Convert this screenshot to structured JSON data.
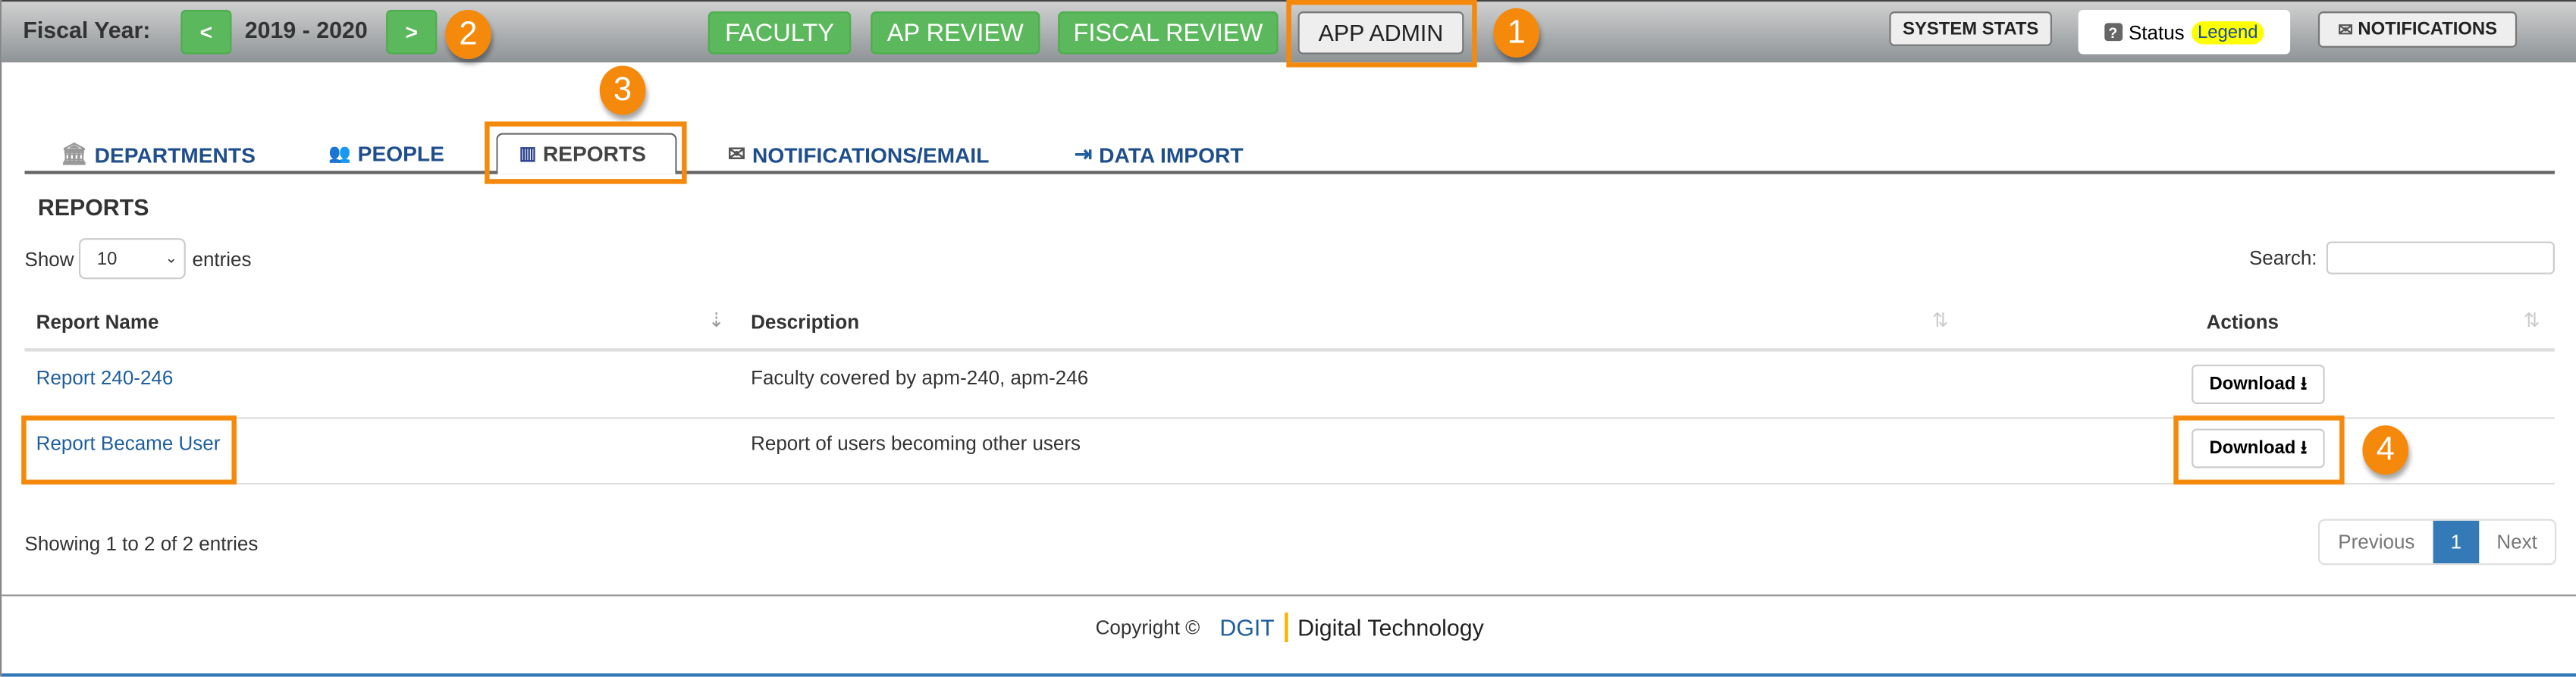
{
  "topbar": {
    "fiscal_year_label": "Fiscal Year:",
    "prev_label": "<",
    "fiscal_year_value": "2019 - 2020",
    "next_label": ">",
    "nav": [
      "FACULTY",
      "AP REVIEW",
      "FISCAL REVIEW",
      "APP ADMIN"
    ],
    "system_stats": "SYSTEM STATS",
    "status_label": "Status",
    "legend_label": "Legend",
    "notifications": "NOTIFICATIONS"
  },
  "annotations": [
    "1",
    "2",
    "3",
    "4"
  ],
  "tabs": [
    {
      "label": "DEPARTMENTS",
      "icon": "building-icon"
    },
    {
      "label": "PEOPLE",
      "icon": "people-icon"
    },
    {
      "label": "REPORTS",
      "icon": "reports-icon",
      "active": true
    },
    {
      "label": "NOTIFICATIONS/EMAIL",
      "icon": "envelope-icon"
    },
    {
      "label": "DATA IMPORT",
      "icon": "import-icon"
    }
  ],
  "section_title": "REPORTS",
  "length": {
    "show": "Show",
    "value": "10",
    "entries": "entries"
  },
  "search": {
    "label": "Search:",
    "value": ""
  },
  "table": {
    "columns": [
      "Report Name",
      "Description",
      "Actions"
    ],
    "rows": [
      {
        "name": "Report 240-246",
        "description": "Faculty covered by apm-240, apm-246",
        "action": "Download"
      },
      {
        "name": "Report Became User",
        "description": "Report of users becoming other users",
        "action": "Download"
      }
    ]
  },
  "info": "Showing 1 to 2 of 2 entries",
  "pagination": {
    "previous": "Previous",
    "current": "1",
    "next": "Next"
  },
  "footer": {
    "copyright": "Copyright ©",
    "brand": "DGIT",
    "org": "Digital Technology"
  },
  "colors": {
    "green": "#5cb85c",
    "annotation": "#f5890b",
    "link": "#1f5fa0",
    "active_page": "#337ab7",
    "legend": "#ffff00"
  }
}
